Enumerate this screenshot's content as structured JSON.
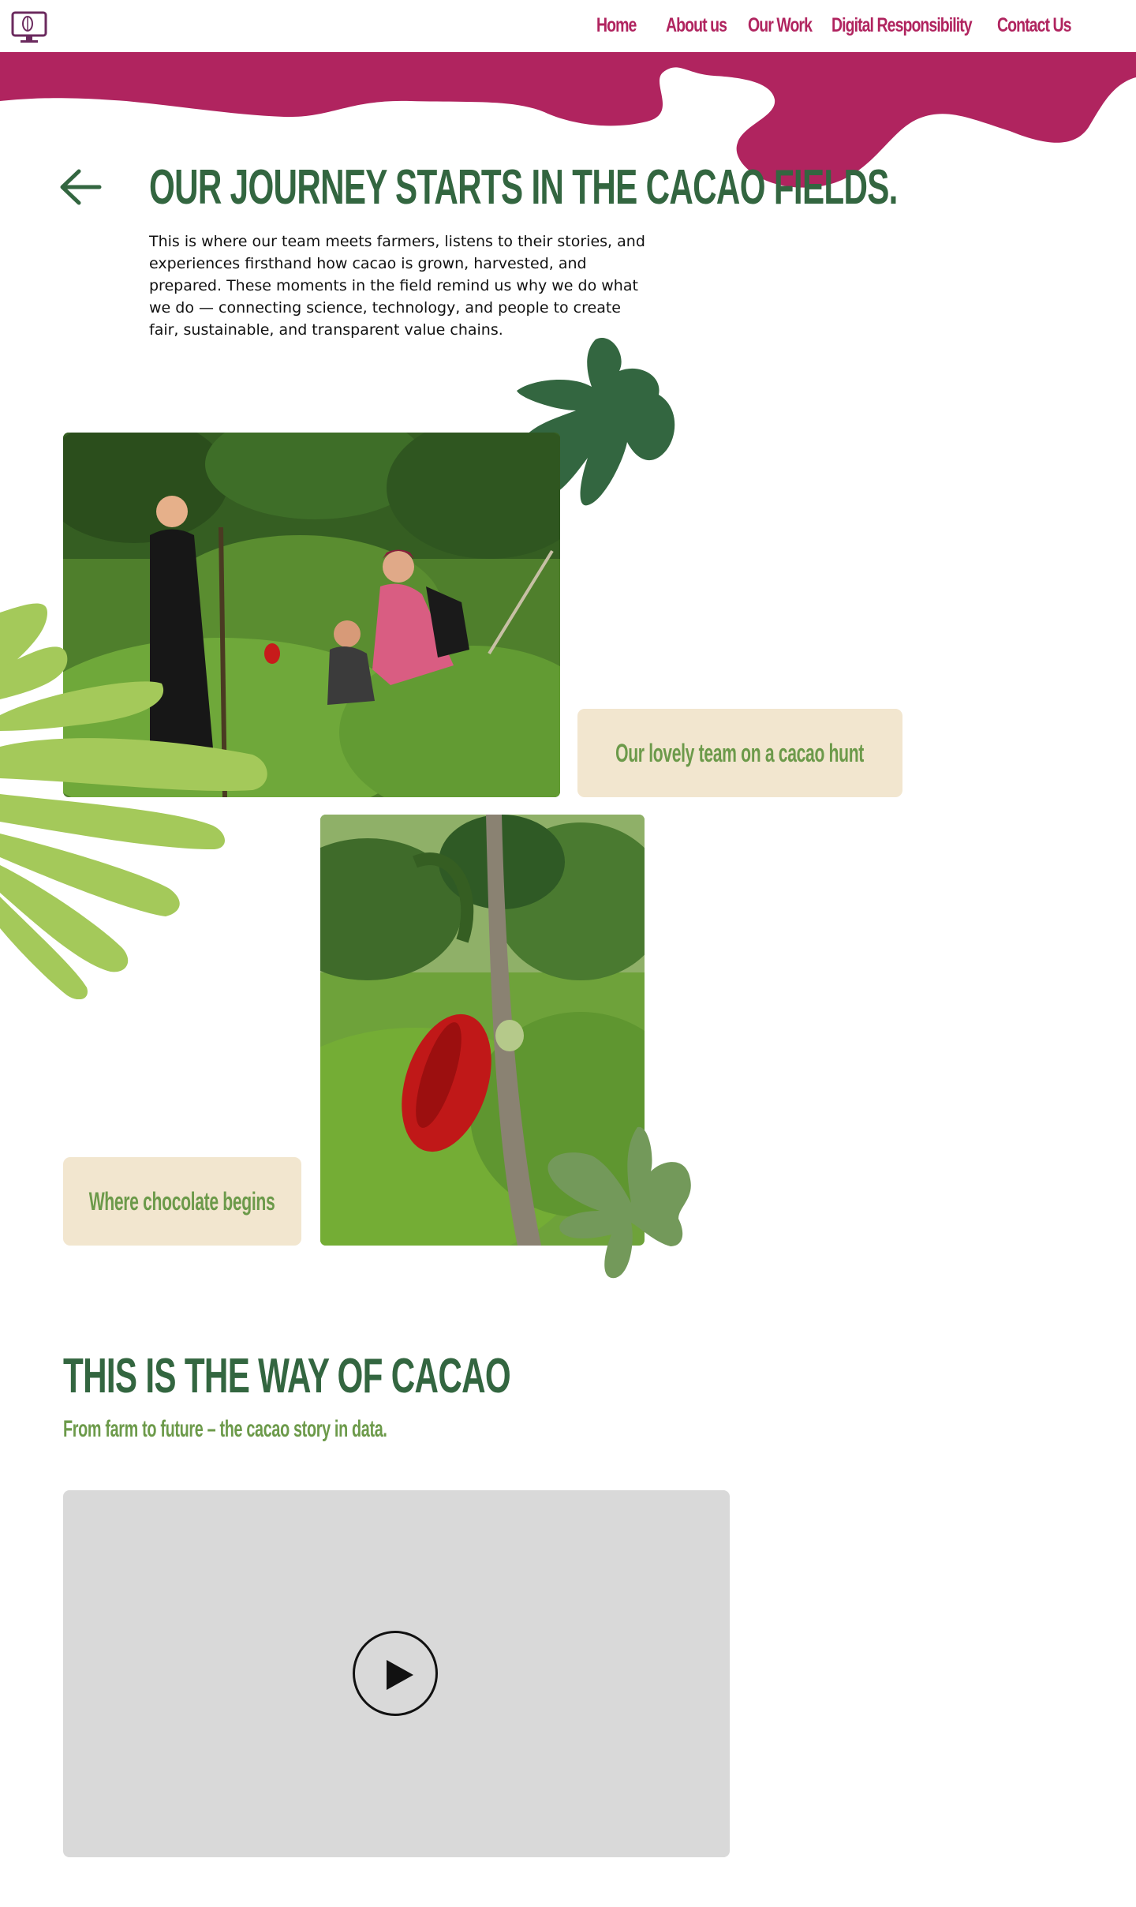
{
  "nav": {
    "items": [
      {
        "label": "Home"
      },
      {
        "label": "About us"
      },
      {
        "label": "Our Work"
      },
      {
        "label": "Digital Responsibility"
      },
      {
        "label": "Contact Us"
      }
    ]
  },
  "hero": {
    "title": "OUR JOURNEY STARTS IN THE CACAO FIELDS.",
    "text": "This is where our team meets farmers, listens to their stories, and experiences firsthand how cacao is grown, harvested, and prepared. These moments in the field remind us why we do what we do — connecting science, technology, and people to create fair, sustainable, and transparent value chains."
  },
  "gallery": {
    "caption_team": "Our lovely team on a cacao hunt",
    "caption_pod": "Where chocolate begins"
  },
  "section": {
    "title": "THIS IS THE WAY OF CACAO",
    "subtitle": "From farm to future – the cacao story in data."
  },
  "colors": {
    "brand_magenta": "#b0245f",
    "dark_green": "#336640",
    "mid_green": "#6c9a4a",
    "light_green": "#a4c95a",
    "caption_bg": "#f2e6cf",
    "video_bg": "#d9d9d9"
  },
  "icons": {
    "logo": "monitor-cacao-logo-icon",
    "back": "arrow-left-icon",
    "play": "play-icon"
  }
}
